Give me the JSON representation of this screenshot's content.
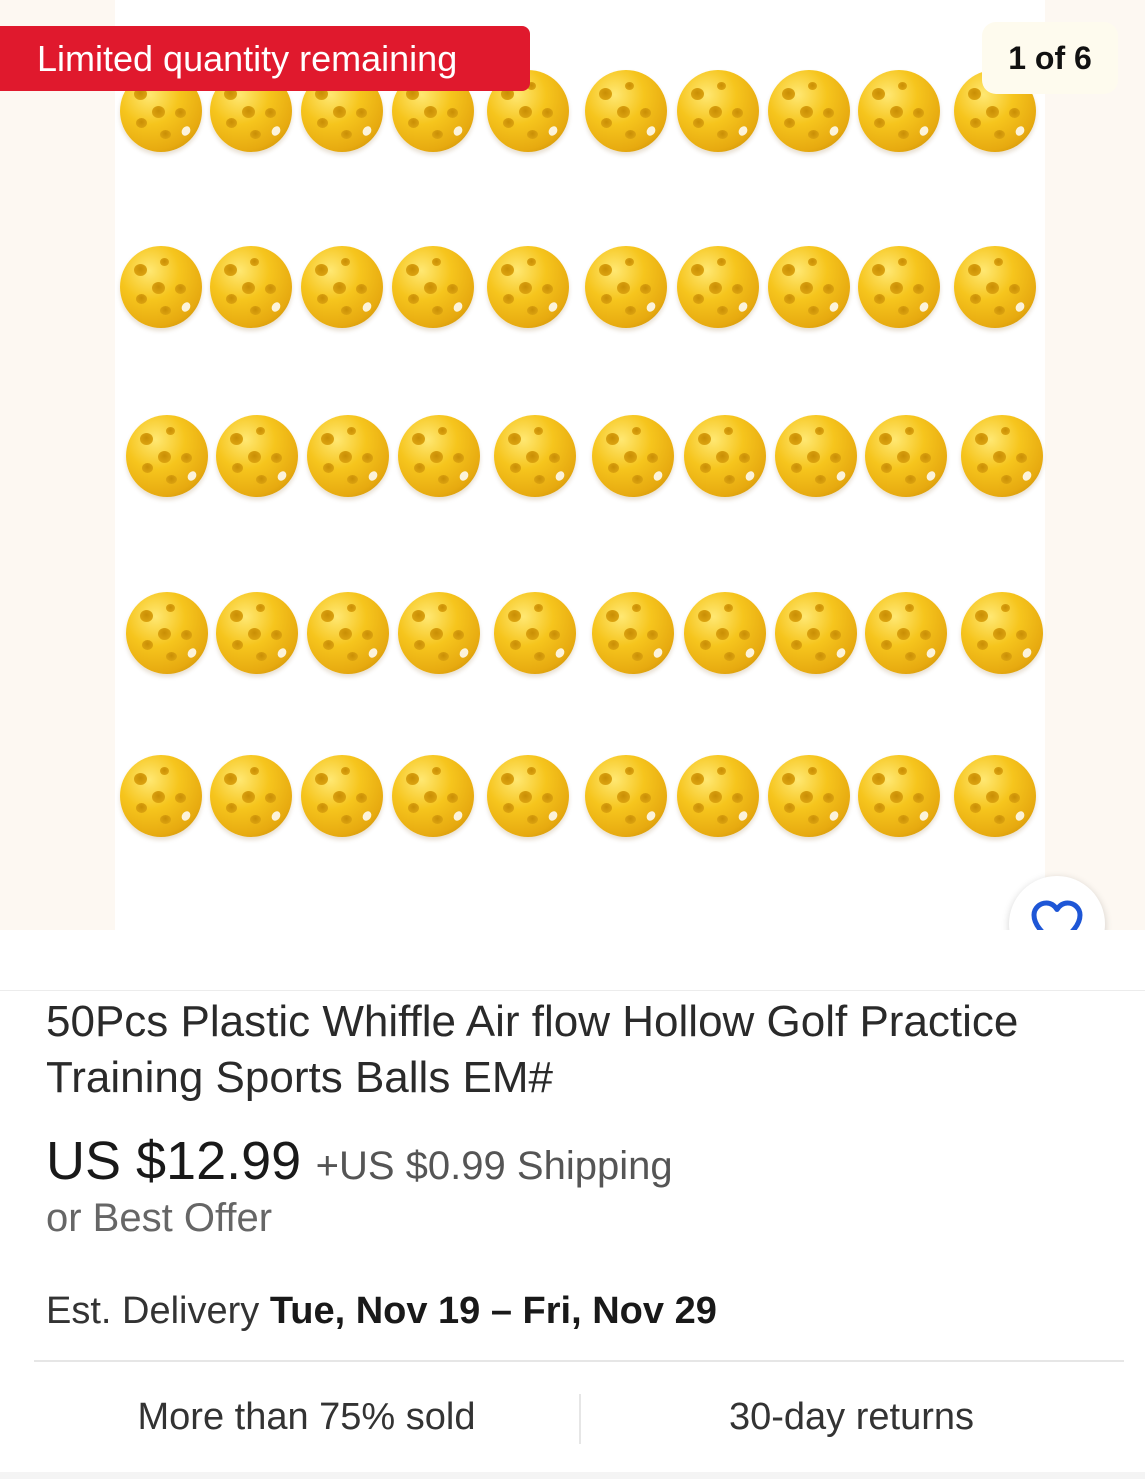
{
  "gallery": {
    "banner_text": "Limited quantity remaining",
    "counter_text": "1 of 6",
    "image_count": 6,
    "current_image": 1,
    "photo_ball_rows": 5,
    "photo_balls_per_row": 10
  },
  "favorite": {
    "icon": "heart-outline-icon",
    "color": "#1e56d6"
  },
  "listing": {
    "title": "50Pcs Plastic Whiffle Air flow Hollow Golf Practice Training Sports Balls EM#",
    "price": "US $12.99",
    "shipping": "+US $0.99 Shipping",
    "best_offer": "or Best Offer",
    "delivery_label": "Est. Delivery",
    "delivery_range": "Tue, Nov 19 – Fri, Nov 29"
  },
  "stats": {
    "sold": "More than 75% sold",
    "returns": "30-day returns"
  },
  "colors": {
    "banner_red": "#e0192d",
    "ball_yellow": "#f6c51d",
    "heart_blue": "#1e56d6"
  }
}
